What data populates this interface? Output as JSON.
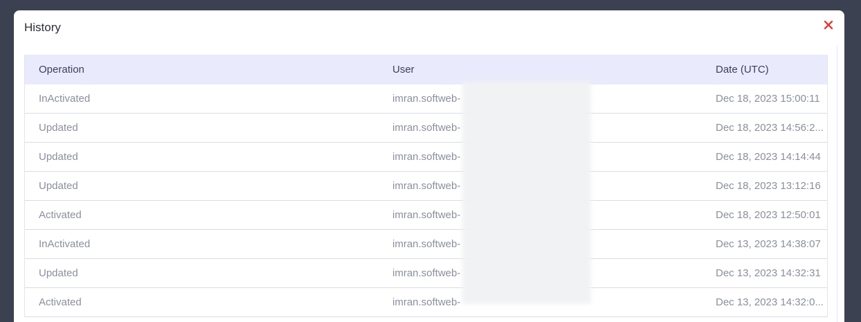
{
  "modal": {
    "title": "History",
    "close_icon": "close-icon",
    "close_color": "#e53935"
  },
  "table": {
    "headers": [
      "Operation",
      "User",
      "Date (UTC)"
    ],
    "rows": [
      {
        "operation": "InActivated",
        "user": "imran.softweb-",
        "date": "Dec 18, 2023 15:00:11"
      },
      {
        "operation": "Updated",
        "user": "imran.softweb-",
        "date": "Dec 18, 2023 14:56:2..."
      },
      {
        "operation": "Updated",
        "user": "imran.softweb-",
        "date": "Dec 18, 2023 14:14:44"
      },
      {
        "operation": "Updated",
        "user": "imran.softweb-",
        "date": "Dec 18, 2023 13:12:16"
      },
      {
        "operation": "Activated",
        "user": "imran.softweb-",
        "date": "Dec 18, 2023 12:50:01"
      },
      {
        "operation": "InActivated",
        "user": "imran.softweb-",
        "date": "Dec 13, 2023 14:38:07"
      },
      {
        "operation": "Updated",
        "user": "imran.softweb-",
        "date": "Dec 13, 2023 14:32:31"
      },
      {
        "operation": "Activated",
        "user": "imran.softweb-",
        "date": "Dec 13, 2023 14:32:0..."
      }
    ]
  }
}
